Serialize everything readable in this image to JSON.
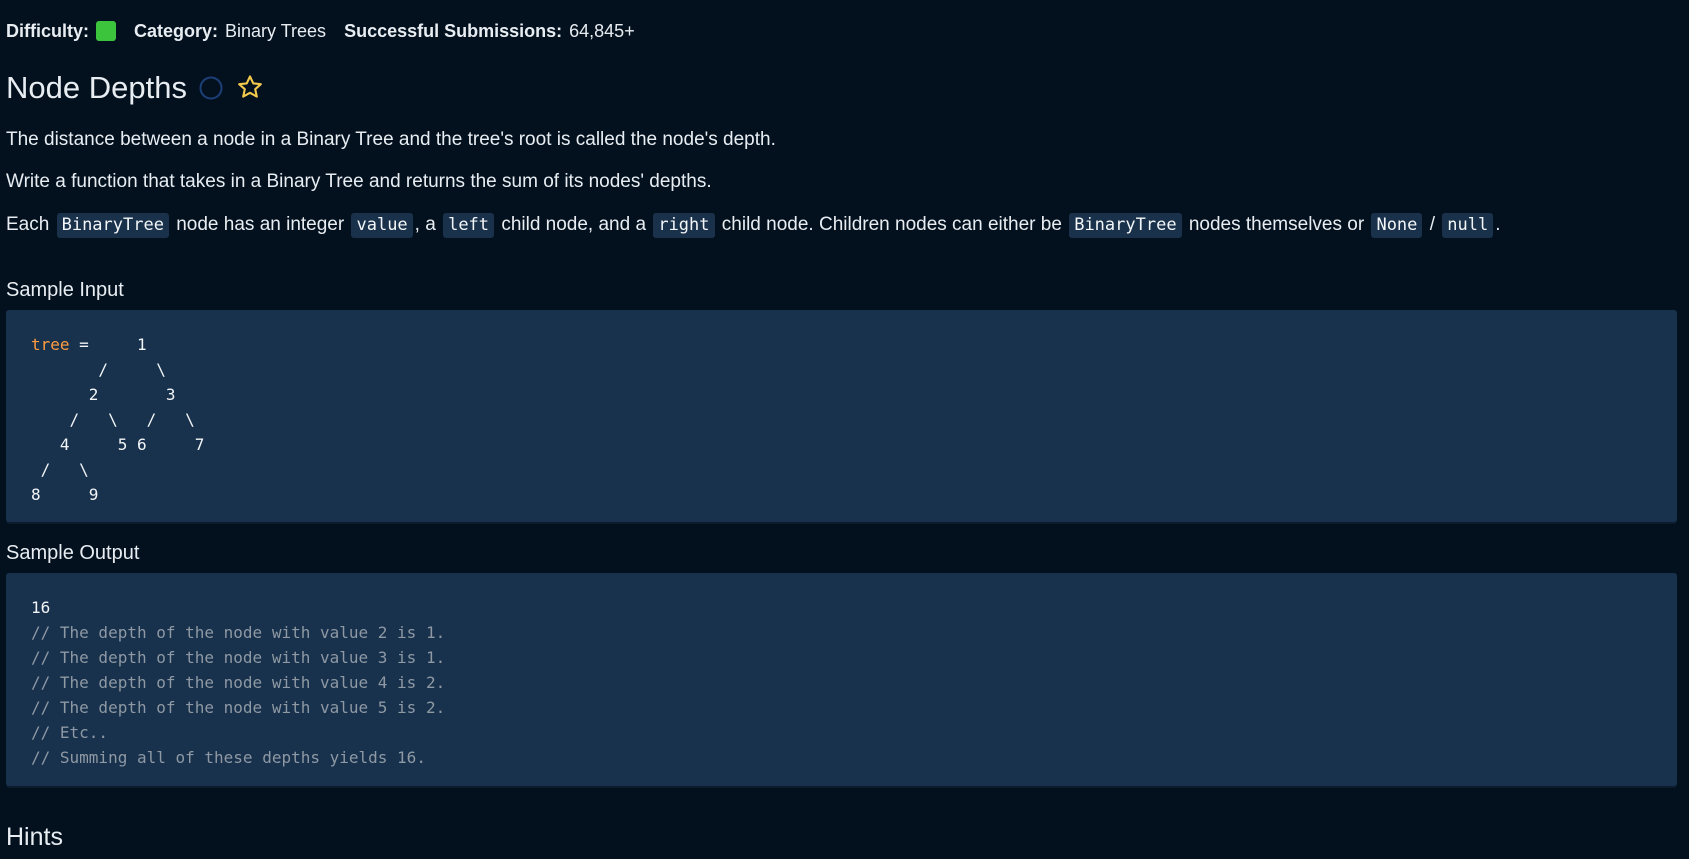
{
  "meta": {
    "difficulty_label": "Difficulty:",
    "difficulty_color": "#3cc43d",
    "category_label": "Category:",
    "category_value": "Binary Trees",
    "submissions_label": "Successful Submissions:",
    "submissions_value": "64,845+"
  },
  "title": {
    "text": "Node Depths",
    "status_icon": "circle-outline-icon",
    "favorite_icon": "star-outline-icon"
  },
  "description": {
    "paragraph_1": "The distance between a node in a Binary Tree and the tree's root is called the node's depth.",
    "paragraph_2": "Write a function that takes in a Binary Tree and returns the sum of its nodes' depths.",
    "paragraph_3": {
      "text_1": "Each",
      "code_1": "BinaryTree",
      "text_2": "node has an integer",
      "code_2": "value",
      "text_3": ", a",
      "code_3": "left",
      "text_4": "child node, and a",
      "code_4": "right",
      "text_5": "child node. Children nodes can either be",
      "code_5": "BinaryTree",
      "text_6": "nodes themselves or",
      "code_6": "None",
      "text_7": "/",
      "code_7": "null",
      "text_8": "."
    }
  },
  "sample_input": {
    "title": "Sample Input",
    "variable": "tree",
    "tree_text": " =     1\n       /     \\\n      2       3\n    /   \\   /   \\\n   4     5 6     7\n /   \\\n8     9"
  },
  "sample_output": {
    "title": "Sample Output",
    "result": "16",
    "comments": [
      "// The depth of the node with value 2 is 1.",
      "// The depth of the node with value 3 is 1.",
      "// The depth of the node with value 4 is 2.",
      "// The depth of the node with value 5 is 2.",
      "// Etc..",
      "// Summing all of these depths yields 16."
    ]
  },
  "hints": {
    "title": "Hints"
  }
}
